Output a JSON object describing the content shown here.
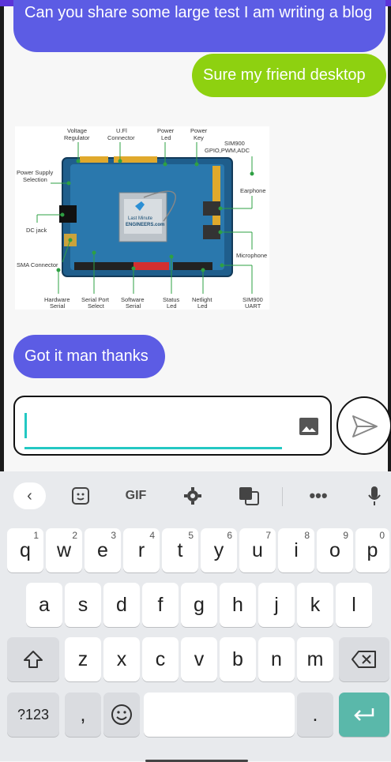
{
  "messages": [
    {
      "from": "them",
      "text": "Can you share some large test I am writing a blog"
    },
    {
      "from": "me",
      "text": "Sure my friend desktop"
    },
    {
      "from": "them",
      "text": "Got it man thanks"
    }
  ],
  "image": {
    "brand": "Last Minute ENGINEERS.com",
    "labels": {
      "voltage_regulator": "Voltage Regulator",
      "ufl_connector": "U.Fl Connector",
      "power_led": "Power Led",
      "power_key": "Power Key",
      "sim900_gpio": "SIM900 GPIO,PWM,ADC",
      "power_supply_selection": "Power Supply Selection",
      "earphone": "Earphone",
      "dc_jack": "DC jack",
      "microphone": "Microphone",
      "sma_connector": "SMA Connector",
      "hardware_serial": "Hardware Serial",
      "serial_port_select": "Serial Port Select",
      "software_serial": "Software Serial",
      "status_led": "Status Led",
      "netlight_led": "Netlight Led",
      "sim900_uart": "SIM900 UART"
    }
  },
  "composer": {
    "value": "",
    "placeholder": ""
  },
  "keyboard": {
    "toolbar": {
      "gif": "GIF"
    },
    "row1": [
      {
        "k": "q",
        "n": "1"
      },
      {
        "k": "w",
        "n": "2"
      },
      {
        "k": "e",
        "n": "3"
      },
      {
        "k": "r",
        "n": "4"
      },
      {
        "k": "t",
        "n": "5"
      },
      {
        "k": "y",
        "n": "6"
      },
      {
        "k": "u",
        "n": "7"
      },
      {
        "k": "i",
        "n": "8"
      },
      {
        "k": "o",
        "n": "9"
      },
      {
        "k": "p",
        "n": "0"
      }
    ],
    "row2": [
      "a",
      "s",
      "d",
      "f",
      "g",
      "h",
      "j",
      "k",
      "l"
    ],
    "row3": [
      "z",
      "x",
      "c",
      "v",
      "b",
      "n",
      "m"
    ],
    "symbols": "?123",
    "comma": ",",
    "period": "."
  },
  "colors": {
    "incoming": "#5c5ce4",
    "outgoing": "#8ed110",
    "accent": "#23c8c3",
    "enter": "#5ab8aa"
  }
}
